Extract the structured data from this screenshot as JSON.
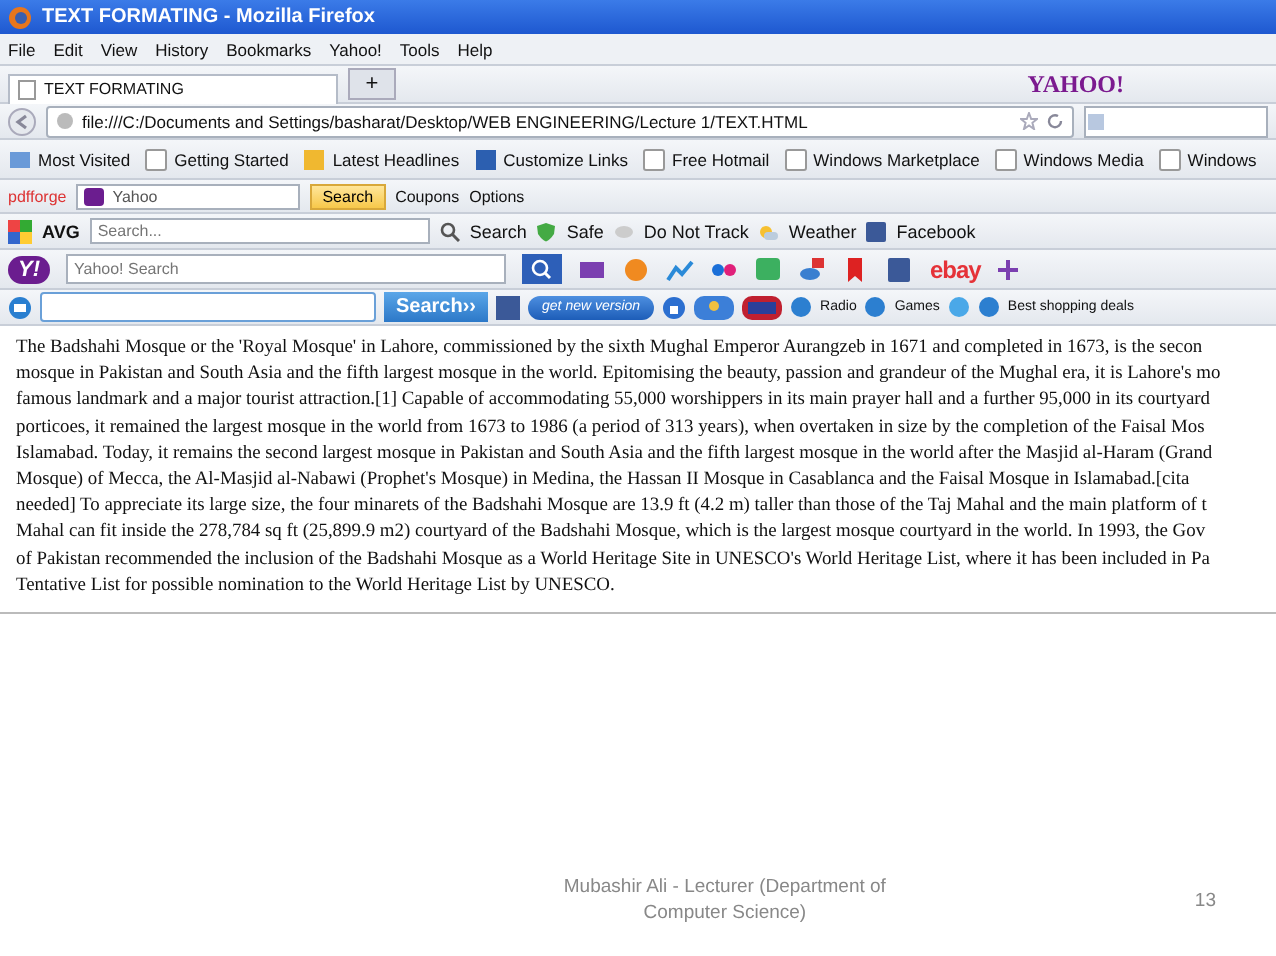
{
  "window": {
    "title": "TEXT FORMATING - Mozilla Firefox"
  },
  "menu": [
    "File",
    "Edit",
    "View",
    "History",
    "Bookmarks",
    "Yahoo!",
    "Tools",
    "Help"
  ],
  "yahoo_brand": "YAHOO!",
  "tabs": [
    {
      "label": "TEXT FORMATING",
      "selected": true
    }
  ],
  "new_tab": "+",
  "address": {
    "value": "file:///C:/Documents and Settings/basharat/Desktop/WEB ENGINEERING/Lecture 1/TEXT.HTML"
  },
  "bookmarks": [
    "Most Visited",
    "Getting Started",
    "Latest Headlines",
    "Customize Links",
    "Free Hotmail",
    "Windows Marketplace",
    "Windows Media",
    "Windows"
  ],
  "pdfforge_bar": {
    "brand": "pdfforge",
    "search": {
      "value": "Yahoo"
    },
    "search_button": "Search",
    "items": [
      "Coupons",
      "Options"
    ]
  },
  "avg_bar": {
    "brand": "AVG",
    "search": {
      "placeholder": "Search..."
    },
    "search_button": "Search",
    "items": [
      "Safe",
      "Do Not Track",
      "Weather",
      "Facebook"
    ]
  },
  "yahoo_bar": {
    "logo": "Y!",
    "search": {
      "placeholder": "Yahoo! Search"
    },
    "ebay": "ebay"
  },
  "extra_bar": {
    "search_button": "Search››",
    "update_button": "get new version",
    "items": [
      "Radio",
      "Games",
      "Best shopping deals"
    ]
  },
  "page_lines": [
    "The Badshahi Mosque or the 'Royal Mosque' in Lahore, commissioned by the sixth Mughal Emperor Aurangzeb in 1671 and completed in 1673, is the secon",
    "mosque in Pakistan and South Asia and the fifth largest mosque in the world. Epitomising the beauty, passion and grandeur of the Mughal era, it is Lahore's mo",
    "famous landmark and a major tourist attraction.[1] Capable of accommodating 55,000 worshippers in its main prayer hall and a further 95,000 in its courtyard",
    "porticoes, it remained the largest mosque in the world from 1673 to 1986 (a period of 313 years), when overtaken in size by the completion of the Faisal Mos",
    "Islamabad. Today, it remains the second largest mosque in Pakistan and South Asia and the fifth largest mosque in the world after the Masjid al-Haram (Grand",
    "Mosque) of Mecca, the Al-Masjid al-Nabawi (Prophet's Mosque) in Medina, the Hassan II Mosque in Casablanca and the Faisal Mosque in Islamabad.[cita",
    "needed] To appreciate its large size, the four minarets of the Badshahi Mosque are 13.9 ft (4.2 m) taller than those of the Taj Mahal and the main platform of t",
    "Mahal can fit inside the 278,784 sq ft (25,899.9 m2) courtyard of the Badshahi Mosque, which is the largest mosque courtyard in the world. In 1993, the Gov",
    "of Pakistan recommended the inclusion of the Badshahi Mosque as a World Heritage Site in UNESCO's World Heritage List, where it has been included in Pa",
    "Tentative List for possible nomination to the World Heritage List by UNESCO."
  ],
  "slide_footer": {
    "author": "Mubashir Ali - Lecturer (Department of Computer Science)",
    "page": "13"
  }
}
